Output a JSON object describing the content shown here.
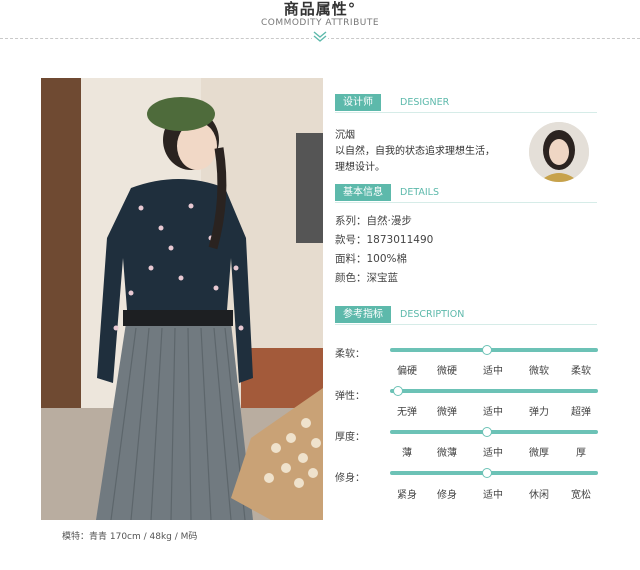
{
  "header": {
    "title": "商品属性°",
    "subtitle": "COMMODITY ATTRIBUTE"
  },
  "photo_caption": "模特：青青  170cm / 48kg / M码",
  "designer": {
    "tag": "设计师",
    "tag_en": "DESIGNER",
    "name": "沉烟",
    "line1": "以自然，自我的状态追求理想生活，",
    "line2": "理想设计。"
  },
  "details": {
    "tag": "基本信息",
    "tag_en": "DETAILS",
    "rows": [
      "系列：自然·漫步",
      "款号：1873011490",
      "面料：100%棉",
      "颜色：深宝蓝"
    ]
  },
  "description": {
    "tag": "参考指标",
    "tag_en": "DESCRIPTION",
    "attributes": [
      {
        "label": "柔软：",
        "options": [
          "偏硬",
          "微硬",
          "适中",
          "微软",
          "柔软"
        ],
        "selected_index": 2
      },
      {
        "label": "弹性：",
        "options": [
          "无弹",
          "微弹",
          "适中",
          "弹力",
          "超弹"
        ],
        "selected_index": 0
      },
      {
        "label": "厚度：",
        "options": [
          "薄",
          "微薄",
          "适中",
          "微厚",
          "厚"
        ],
        "selected_index": 2
      },
      {
        "label": "修身：",
        "options": [
          "紧身",
          "修身",
          "适中",
          "休闲",
          "宽松"
        ],
        "selected_index": 2
      }
    ]
  },
  "colors": {
    "accent": "#5db9ab"
  }
}
